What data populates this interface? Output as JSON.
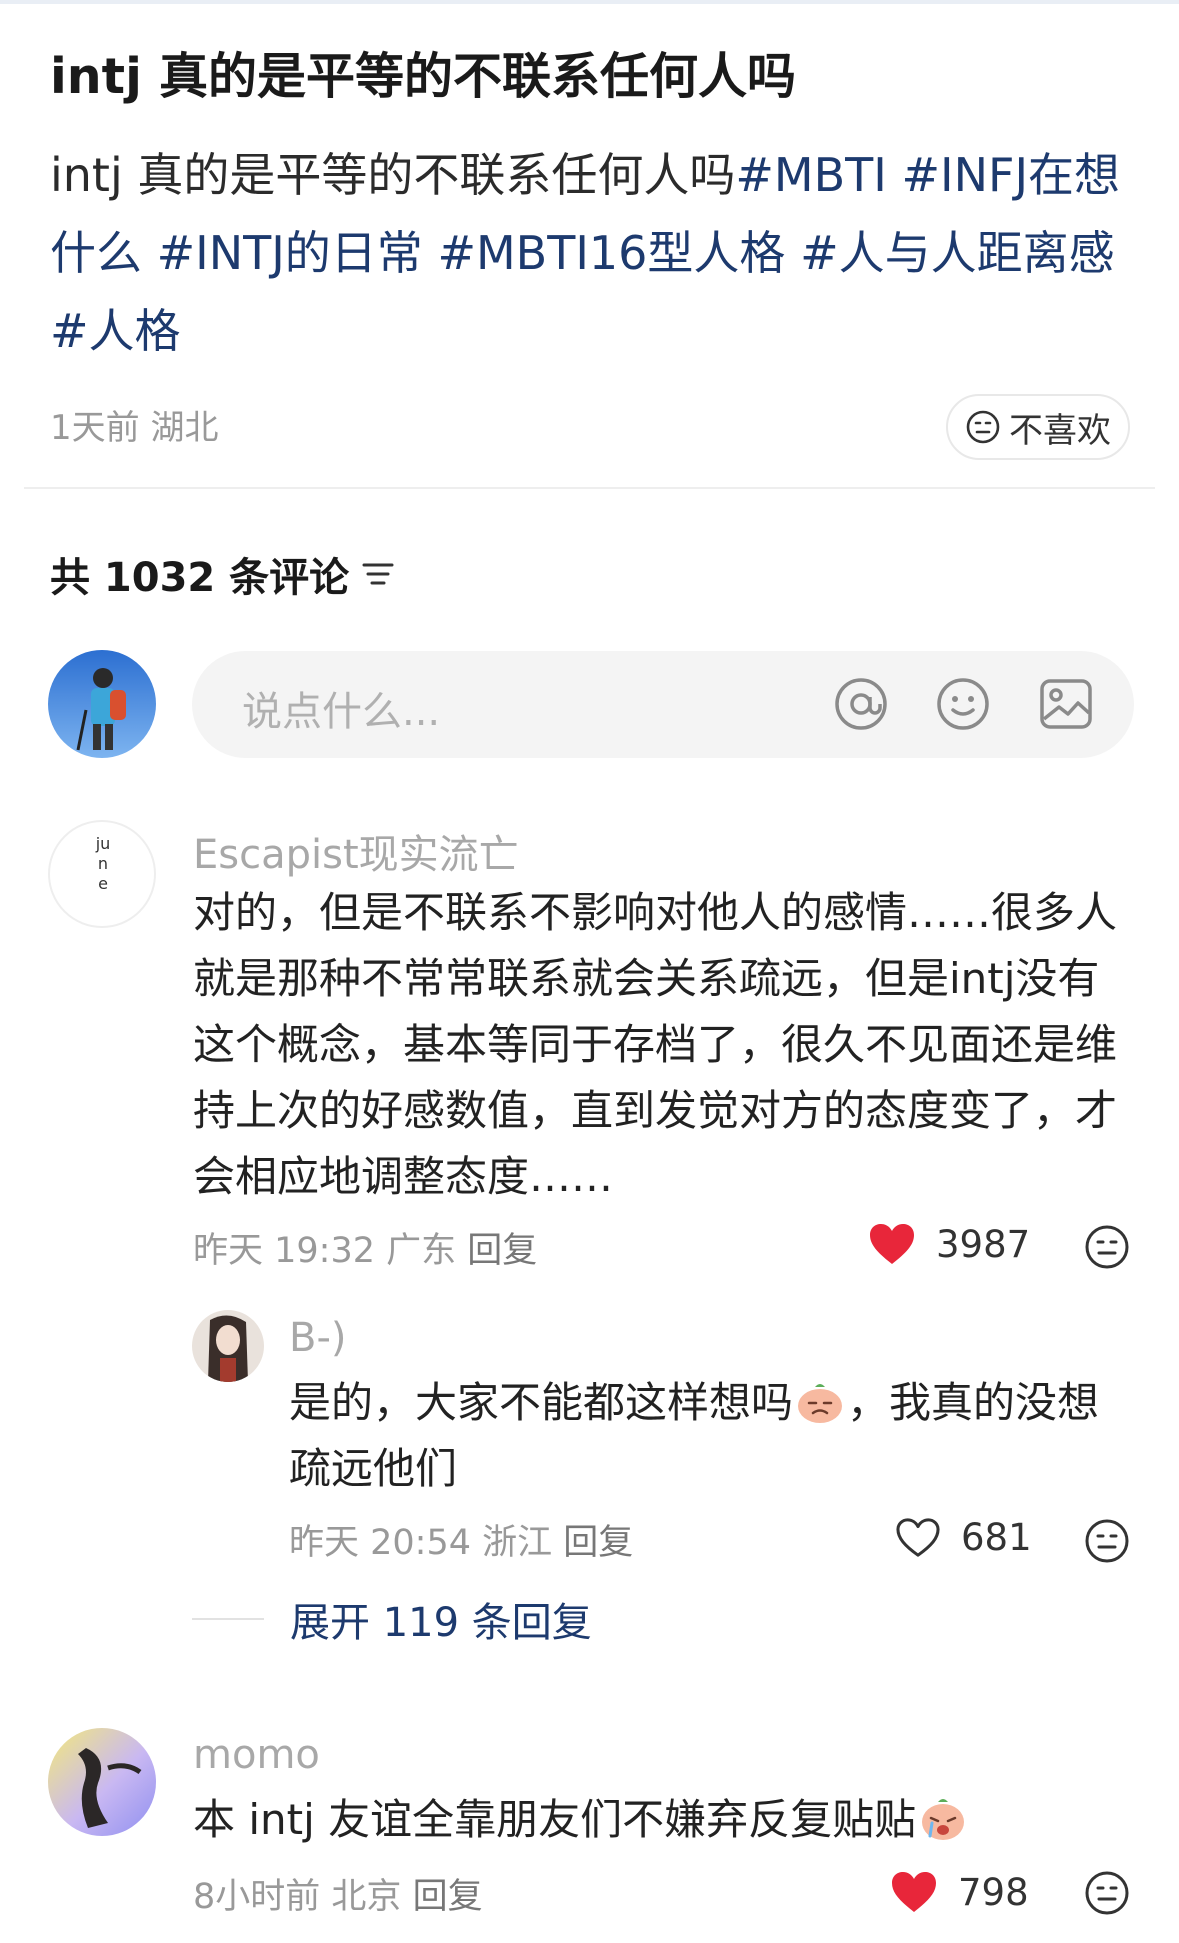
{
  "post": {
    "title": "intj 真的是平等的不联系任何人吗",
    "body_text": "intj 真的是平等的不联系任何人吗",
    "tags": [
      "#MBTI",
      "#INFJ在想什么",
      "#INTJ的日常",
      "#MBTI16型人格",
      "#人与人距离感",
      "#人格"
    ],
    "time": "1天前",
    "location": "湖北",
    "dislike_label": "不喜欢"
  },
  "comments_header": {
    "label": "共 1032 条评论"
  },
  "input": {
    "placeholder": "说点什么..."
  },
  "icons": {
    "mention": "at-icon",
    "emoji": "smile-icon",
    "image": "image-icon",
    "sort": "sort-icon",
    "like": "heart-icon",
    "dislike": "neutral-face-icon"
  },
  "colors": {
    "tag": "#1d3a6e",
    "like_red": "#e8263a",
    "muted": "#999999"
  },
  "comments": [
    {
      "author": "Escapist现实流亡",
      "avatar_text": "june",
      "text": "对的，但是不联系不影响对他人的感情……很多人就是那种不常常联系就会关系疏远，但是intj没有这个概念，基本等同于存档了，很久不见面还是维持上次的好感数值，直到发觉对方的态度变了，才会相应地调整态度……",
      "time": "昨天 19:32",
      "location": "广东",
      "reply_label": "回复",
      "likes": "3987",
      "liked": true,
      "replies": [
        {
          "author": "B-)",
          "text_before": "是的，大家不能都这样想吗",
          "text_after": "，我真的没想疏远他们",
          "time": "昨天 20:54",
          "location": "浙江",
          "reply_label": "回复",
          "likes": "681",
          "liked": false
        }
      ],
      "expand_label": "展开 119 条回复"
    },
    {
      "author": "momo",
      "text_before": "本 intj 友谊全靠朋友们不嫌弃反复贴贴",
      "time": "8小时前",
      "location": "北京",
      "reply_label": "回复",
      "likes": "798",
      "liked": true
    }
  ]
}
